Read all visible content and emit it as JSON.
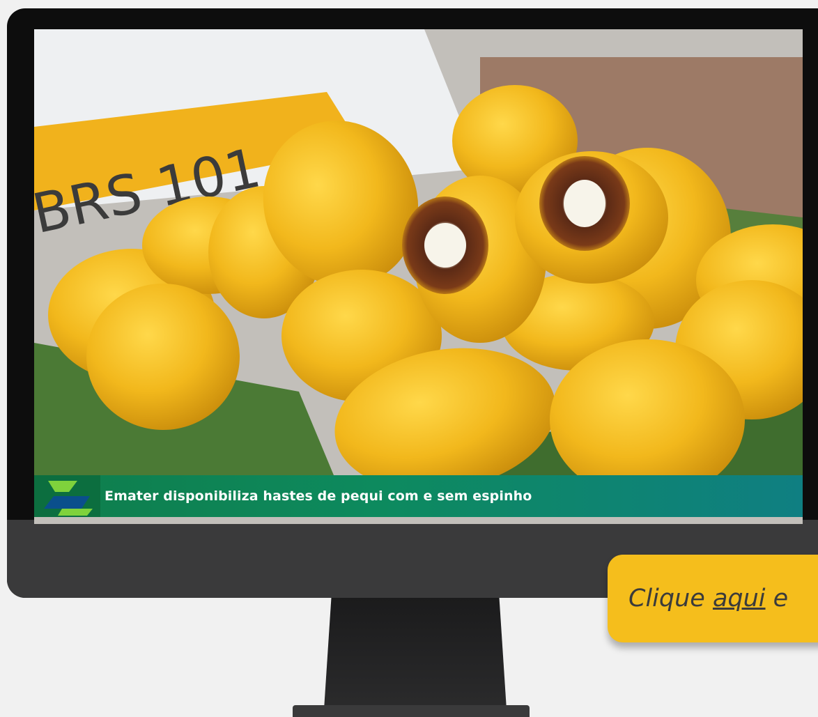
{
  "screen": {
    "sign_text": "BRS 101",
    "headline": "Emater disponibiliza hastes de pequi com e sem espinho"
  },
  "cta": {
    "prefix": "Clique ",
    "link_text": "aqui",
    "suffix": " e"
  },
  "colors": {
    "cta_background": "#f5be1c",
    "lower_third_green": "#0f7d4b",
    "logo_lime": "#7fd23c",
    "monitor_bezel": "#0d0d0d",
    "monitor_chin": "#3a3a3b"
  }
}
